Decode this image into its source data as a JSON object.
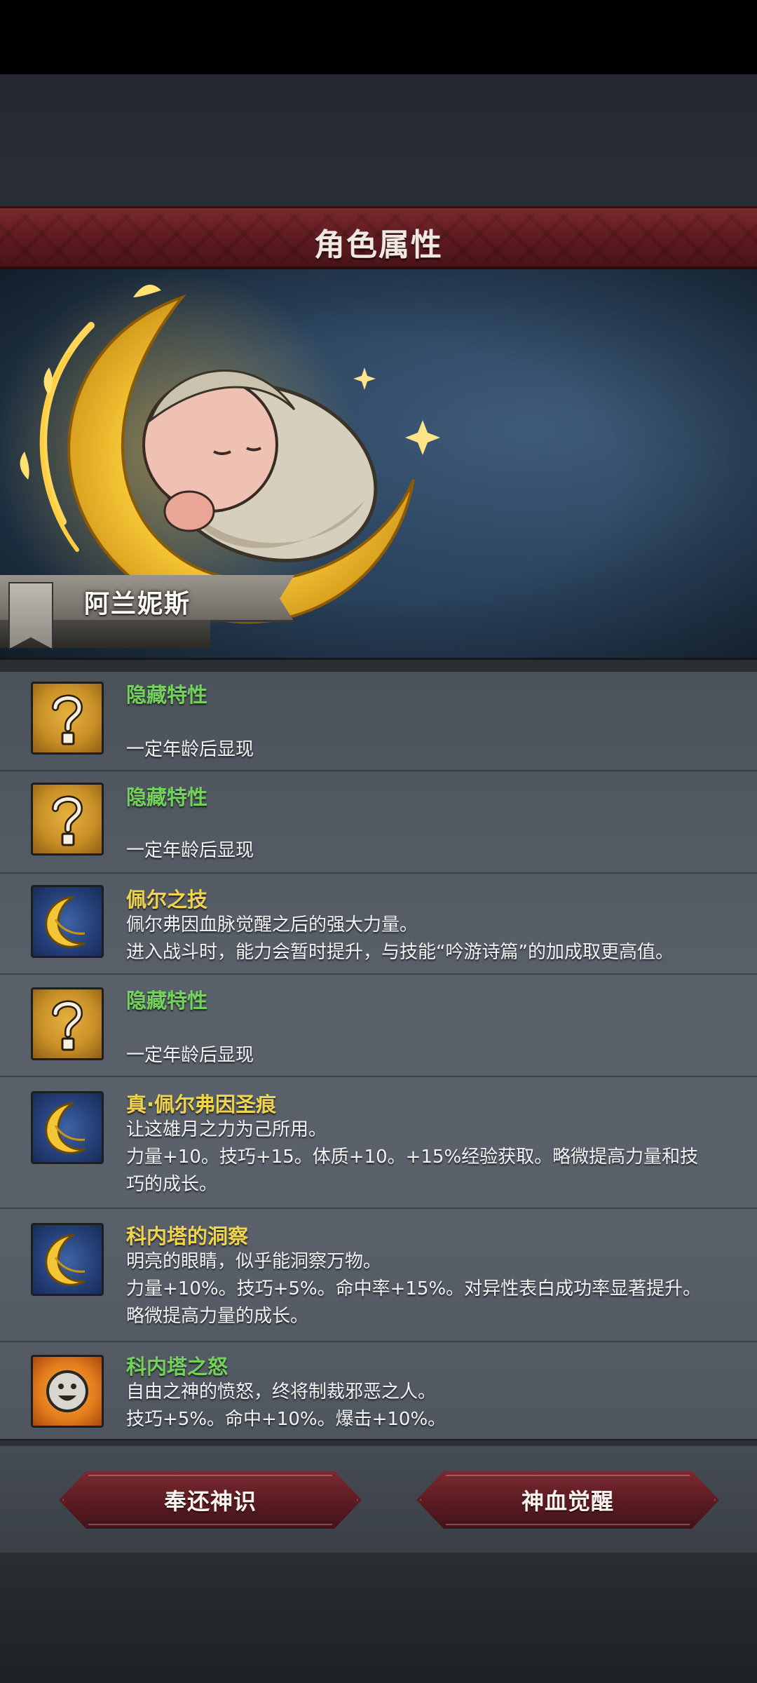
{
  "header": {
    "title": "角色属性"
  },
  "character": {
    "name": "阿兰妮斯"
  },
  "traits": [
    {
      "title": "隐藏特性",
      "title_color": "green",
      "icon": "question-mark-icon",
      "lines": [
        "",
        "一定年龄后显现"
      ]
    },
    {
      "title": "隐藏特性",
      "title_color": "green",
      "icon": "question-mark-icon",
      "lines": [
        "",
        "一定年龄后显现"
      ]
    },
    {
      "title": "佩尔之技",
      "title_color": "yellow",
      "icon": "crescent-moon-icon",
      "lines": [
        "佩尔弗因血脉觉醒之后的强大力量。",
        "进入战斗时，能力会暂时提升，与技能“吟游诗篇”的加成取更高值。"
      ]
    },
    {
      "title": "隐藏特性",
      "title_color": "green",
      "icon": "question-mark-icon",
      "lines": [
        "",
        "一定年龄后显现"
      ]
    },
    {
      "title": "真·佩尔弗因圣痕",
      "title_color": "yellow",
      "icon": "crescent-moon-icon",
      "lines": [
        "让这雄月之力为己所用。",
        "力量+10。技巧+15。体质+10。+15%经验获取。略微提高力量和技",
        "巧的成长。"
      ]
    },
    {
      "title": "科内塔的洞察",
      "title_color": "yellow",
      "icon": "crescent-moon-icon",
      "lines": [
        "明亮的眼睛，似乎能洞察万物。",
        "力量+10%。技巧+5%。命中率+15%。对异性表白成功率显著提升。",
        "略微提高力量的成长。"
      ]
    },
    {
      "title": "科内塔之怒",
      "title_color": "green",
      "icon": "smiling-face-icon",
      "lines": [
        "自由之神的愤怒，终将制裁邪恶之人。",
        "技巧+5%。命中+10%。爆击+10%。"
      ]
    }
  ],
  "buttons": {
    "left": "奉还神识",
    "right": "神血觉醒"
  },
  "colors": {
    "accent_red": "#5c1a1f",
    "green_title": "#72d25a",
    "yellow_title": "#efd44c"
  }
}
